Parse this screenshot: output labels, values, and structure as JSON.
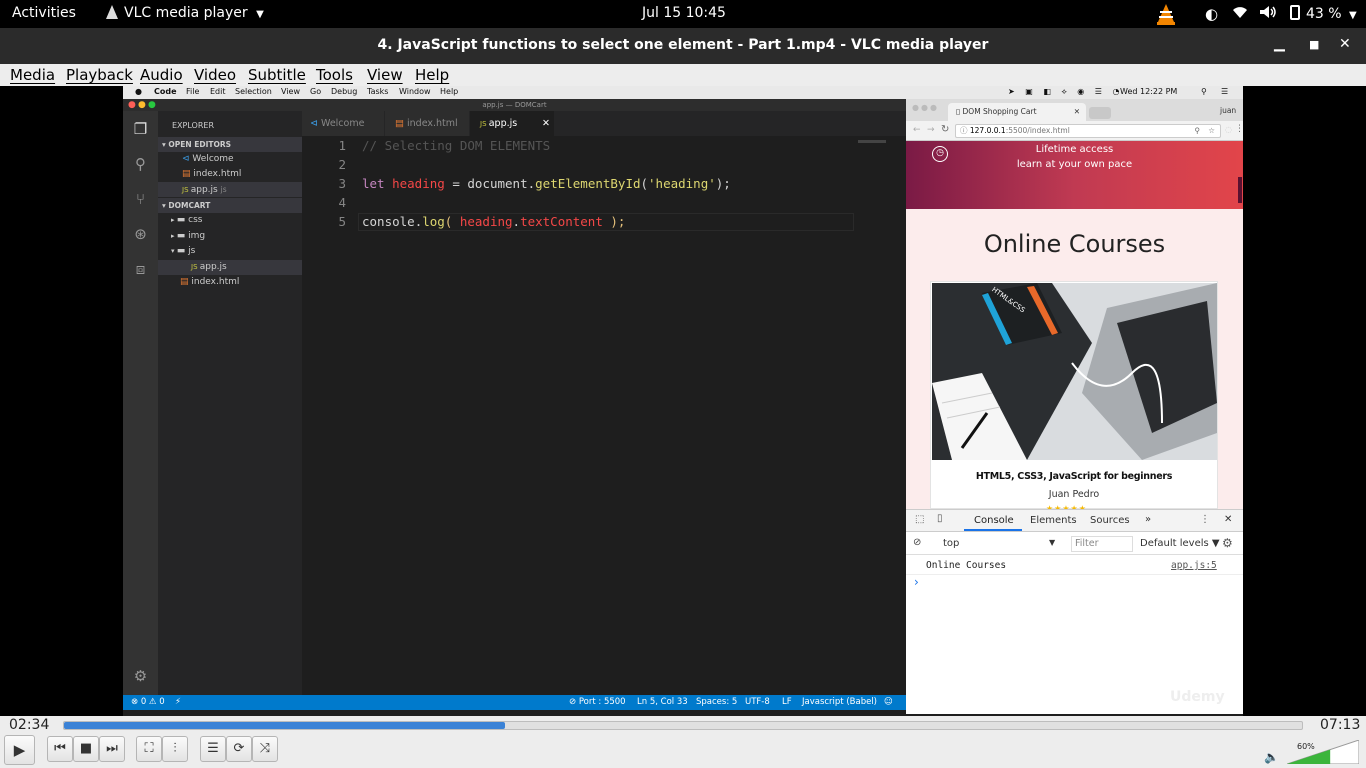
{
  "topbar": {
    "activities": "Activities",
    "app_name": "VLC media player",
    "datetime": "Jul 15  10:45",
    "battery": "43 %"
  },
  "vlc": {
    "window_title": "4. JavaScript functions to select one element - Part 1.mp4 - VLC media player",
    "menu": [
      "Media",
      "Playback",
      "Audio",
      "Video",
      "Subtitle",
      "Tools",
      "View",
      "Help"
    ],
    "elapsed": "02:34",
    "total": "07:13",
    "progress": 0.356,
    "volume_label": "60%",
    "volume": 0.6
  },
  "mac": {
    "menus": [
      "Code",
      "File",
      "Edit",
      "Selection",
      "View",
      "Go",
      "Debug",
      "Tasks",
      "Window",
      "Help"
    ],
    "clock": "Wed 12:22 PM"
  },
  "vscode": {
    "title": "app.js — DOMCart",
    "explorer": "EXPLORER",
    "open_editors": "OPEN EDITORS",
    "open_files": [
      "Welcome",
      "index.html",
      "app.js"
    ],
    "open_hint": "js",
    "project": "DOMCART",
    "tree": [
      "css",
      "img",
      "js",
      "app.js",
      "index.html"
    ],
    "tabs": [
      "Welcome",
      "index.html",
      "app.js"
    ],
    "lines": [
      {
        "n": "1",
        "comment": "// Selecting DOM ELEMENTS"
      },
      {
        "n": "2"
      },
      {
        "n": "3",
        "kw": "let",
        "var": "heading",
        "eq": "=",
        "obj": "document",
        "dot": ".",
        "fn": "getElementById",
        "p1": "(",
        "str": "'heading'",
        "p2": ");"
      },
      {
        "n": "4"
      },
      {
        "n": "5",
        "obj": "console",
        "dot": ".",
        "fn": "log",
        "p1": "( ",
        "var": "heading",
        "dot2": ".",
        "prop": "textContent",
        "p2": " );"
      }
    ],
    "status": {
      "problems": "⊗ 0 ⚠ 0",
      "bolt": "⚡",
      "port": "⊘ Port : 5500",
      "position": "Ln 5, Col 33",
      "spaces": "Spaces: 5",
      "encoding": "UTF-8",
      "eol": "LF",
      "language": "Javascript (Babel)"
    }
  },
  "browser": {
    "tab_title": "DOM Shopping Cart",
    "user": "juan",
    "url_host": "127.0.0.1",
    "url_rest": ":5500/index.html",
    "hero_line1": "Lifetime access",
    "hero_line2": "learn at your own pace",
    "heading": "Online Courses",
    "course_title": "HTML5, CSS3, JavaScript for beginners",
    "author": "Juan Pedro",
    "devtools_tabs": [
      "Console",
      "Elements",
      "Sources",
      "»"
    ],
    "context": "top",
    "filter_placeholder": "Filter",
    "levels": "Default levels ▼",
    "log_text": "Online Courses",
    "log_source": "app.js:5",
    "prompt": "›",
    "watermark": "Udemy",
    "book_label": "HTML&CSS"
  },
  "colors": {
    "vscode_blue": "#007acc",
    "vlc_orange": "#f28500",
    "hero_gradient": "#c03a52"
  }
}
